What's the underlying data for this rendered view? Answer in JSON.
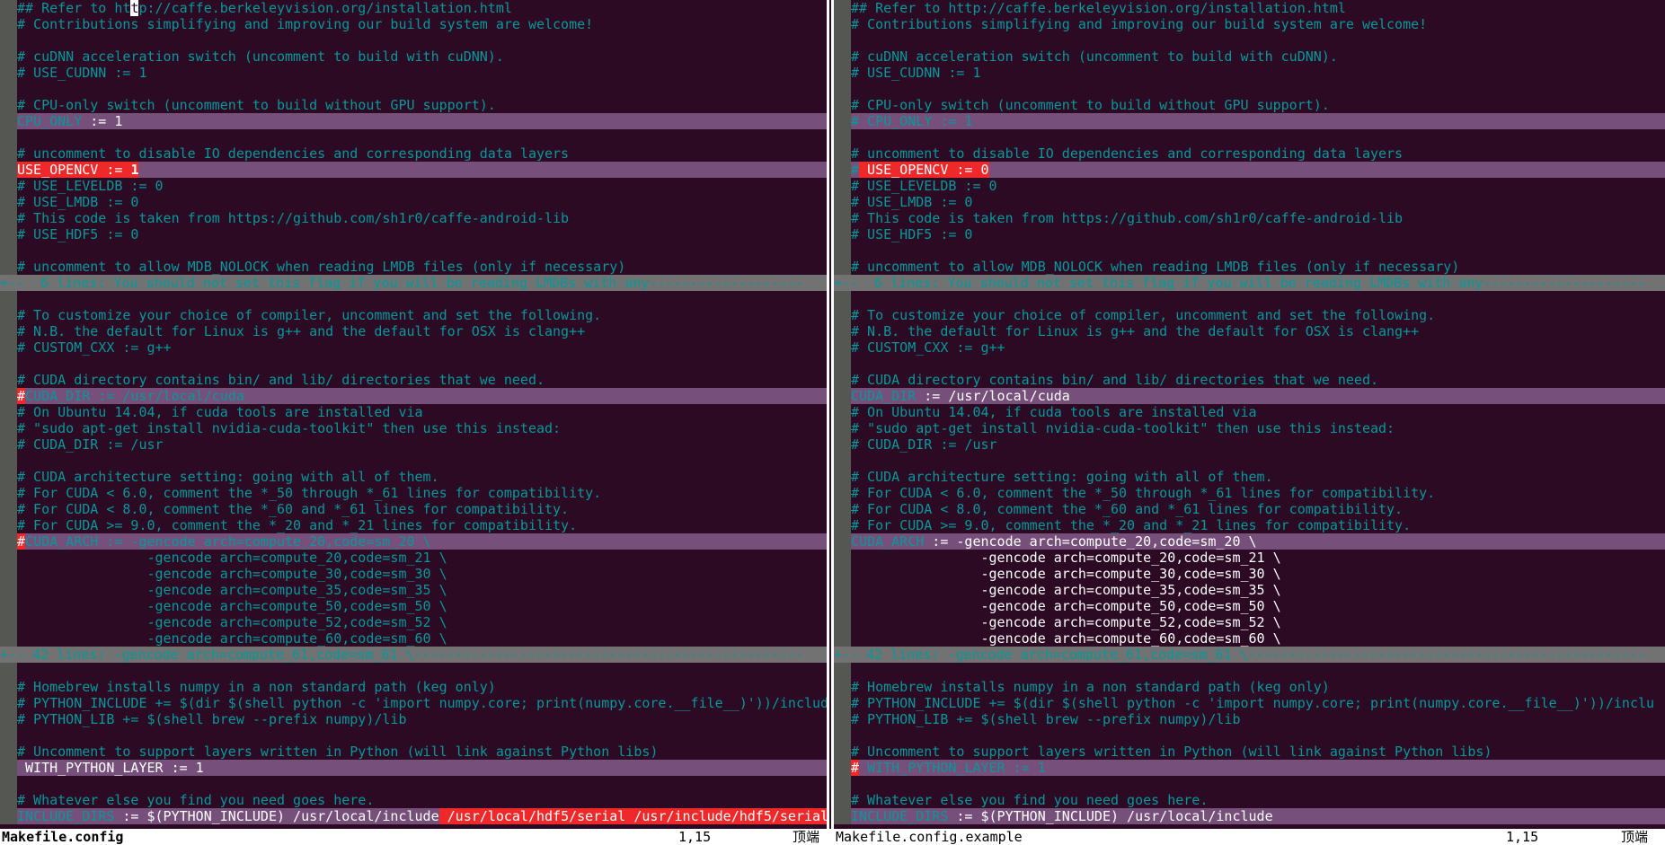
{
  "left": {
    "file_name": "Makefile.config",
    "position": "1,15",
    "percent": "顶端",
    "line_1_before_cursor": "## Refer to ht",
    "line_1_cursor_char": "t",
    "line_1_after_cursor": "p://caffe.berkeleyvision.org/installation.html",
    "cpu_only_var": "CPU_ONLY",
    "cpu_only_rest": " := 1",
    "use_opencv_var": "USE_OPENCV",
    "use_opencv_mid": " := ",
    "use_opencv_val": "1",
    "cuda_dir_hash": "#",
    "cuda_dir_rest": "CUDA_DIR := /usr/local/cuda",
    "cuda_arch_hash": "#",
    "cuda_arch_rest": "CUDA_ARCH := -gencode arch=compute_20,code=sm_20 \\",
    "with_python_layer": " WITH_PYTHON_LAYER := 1",
    "include_dirs_var": "INCLUDE_DIRS",
    "include_dirs_mid": " := $(PYTHON_INCLUDE) /usr/local/include",
    "include_dirs_add": " /usr/local/hdf5/serial /usr/include/hdf5/serial"
  },
  "right": {
    "file_name": "Makefile.config.example",
    "position": "1,15",
    "percent": "顶端",
    "line_1": "## Refer to http://caffe.berkeleyvision.org/installation.html",
    "cpu_only_hash": "#",
    "cpu_only_rest": " CPU_ONLY := 1",
    "use_opencv_hash": "#",
    "use_opencv_mid": " USE_OPENCV",
    "use_opencv_rest": " := ",
    "use_opencv_val": "0",
    "cuda_dir_var": "CUDA_DIR",
    "cuda_dir_rest": " := /usr/local/cuda",
    "cuda_arch_var": "CUDA_ARCH",
    "cuda_arch_rest": " := -gencode arch=compute_20,code=sm_20 \\",
    "with_python_hash": "#",
    "with_python_rest": " WITH_PYTHON_LAYER := 1",
    "include_dirs_var": "INCLUDE_DIRS",
    "include_dirs_rest": " := $(PYTHON_INCLUDE) /usr/local/include"
  },
  "common": {
    "contrib": "# Contributions simplifying and improving our build system are welcome!",
    "cudnn_comment": "# cuDNN acceleration switch (uncomment to build with cuDNN).",
    "use_cudnn": "# USE_CUDNN := 1",
    "cpu_comment": "# CPU-only switch (uncomment to build without GPU support).",
    "io_comment": "# uncomment to disable IO dependencies and corresponding data layers",
    "use_leveldb": "# USE_LEVELDB := 0",
    "use_lmdb": "# USE_LMDB := 0",
    "sh1r0": "# This code is taken from https://github.com/sh1r0/caffe-android-lib",
    "use_hdf5": "# USE_HDF5 := 0",
    "mdb_comment": "# uncomment to allow MDB_NOLOCK when reading LMDB files (only if necessary)",
    "fold_1_left": "+--  6 lines: You should not set this flag if you will be reading LMDBs with any-------------------",
    "fold_1_right": "+--  6 lines: You should not set this flag if you will be reading LMDBs with any--------------------",
    "compiler_comment": "# To customize your choice of compiler, uncomment and set the following.",
    "nb_comment": "# N.B. the default for Linux is g++ and the default for OSX is clang++",
    "custom_cxx": "# CUSTOM_CXX := g++",
    "cuda_dir_comment": "# CUDA directory contains bin/ and lib/ directories that we need.",
    "ubuntu_comment": "# On Ubuntu 14.04, if cuda tools are installed via",
    "apt_comment": "# \"sudo apt-get install nvidia-cuda-toolkit\" then use this instead:",
    "cuda_dir_usr": "# CUDA_DIR := /usr",
    "arch_comment": "# CUDA architecture setting: going with all of them.",
    "cuda6_comment": "# For CUDA < 6.0, comment the *_50 through *_61 lines for compatibility.",
    "cuda8_comment": "# For CUDA < 8.0, comment the *_60 and *_61 lines for compatibility.",
    "cuda9_comment": "# For CUDA >= 9.0, comment the *_20 and *_21 lines for compatibility.",
    "gencode_lines": [
      "                -gencode arch=compute_20,code=sm_21 \\",
      "                -gencode arch=compute_30,code=sm_30 \\",
      "                -gencode arch=compute_35,code=sm_35 \\",
      "                -gencode arch=compute_50,code=sm_50 \\",
      "                -gencode arch=compute_52,code=sm_52 \\",
      "                -gencode arch=compute_60,code=sm_60 \\"
    ],
    "fold_2_left": "+-- 42 lines: -gencode arch=compute_61,code=sm_61 \\------------------------------------------------",
    "fold_2_right": "+-- 42 lines: -gencode arch=compute_61,code=sm_61 \\-------------------------------------------------",
    "homebrew_comment": "# Homebrew installs numpy in a non standard path (keg only)",
    "python_include_left": "# PYTHON_INCLUDE += $(dir $(shell python -c 'import numpy.core; print(numpy.core.__file__)'))/includ",
    "python_include_right": "# PYTHON_INCLUDE += $(dir $(shell python -c 'import numpy.core; print(numpy.core.__file__)'))/inclu",
    "python_lib": "# PYTHON_LIB += $(shell brew --prefix numpy)/lib",
    "python_layer_comment": "# Uncomment to support layers written in Python (will link against Python libs)",
    "whatever_comment": "# Whatever else you find you need goes here."
  }
}
